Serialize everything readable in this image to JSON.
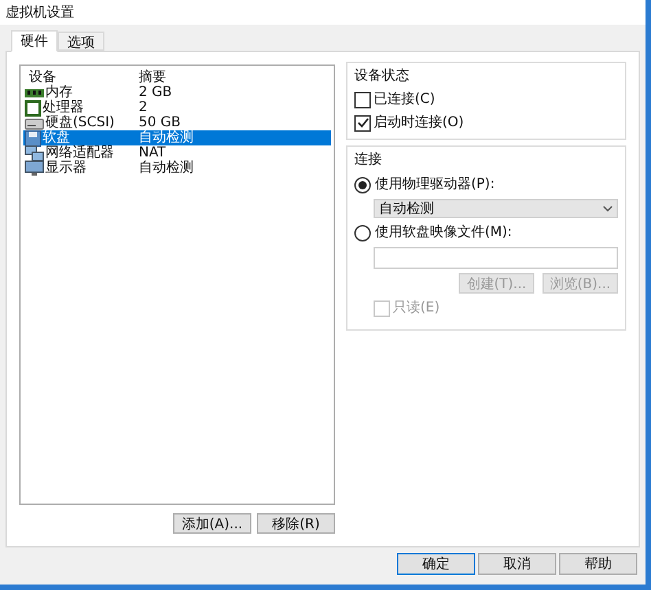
{
  "window": {
    "title": "虚拟机设置"
  },
  "tabs": [
    {
      "label": "硬件",
      "selected": true
    },
    {
      "label": "选项",
      "selected": false
    }
  ],
  "device_list": {
    "columns": [
      "设备",
      "摘要"
    ],
    "rows": [
      {
        "kind": "memory",
        "name": "内存",
        "summary": "2 GB",
        "selected": false
      },
      {
        "kind": "cpu",
        "name": "处理器",
        "summary": "2",
        "selected": false
      },
      {
        "kind": "disk",
        "name": "硬盘(SCSI)",
        "summary": "50 GB",
        "selected": false
      },
      {
        "kind": "floppy",
        "name": "软盘",
        "summary": "自动检测",
        "selected": true
      },
      {
        "kind": "network",
        "name": "网络适配器",
        "summary": "NAT",
        "selected": false
      },
      {
        "kind": "display",
        "name": "显示器",
        "summary": "自动检测",
        "selected": false
      }
    ],
    "buttons": [
      "添加(A)...",
      "移除(R)"
    ]
  },
  "device_status": {
    "title": "设备状态",
    "options": [
      {
        "label": "已连接(C)",
        "checked": false
      },
      {
        "label": "启动时连接(O)",
        "checked": true
      }
    ]
  },
  "connection": {
    "title": "连接",
    "physical": {
      "label": "使用物理驱动器(P):",
      "selected": true,
      "value": "自动检测"
    },
    "image": {
      "label": "使用软盘映像文件(M):",
      "selected": false,
      "buttons": [
        "创建(T)...",
        "浏览(B)..."
      ],
      "readonly": {
        "label": "只读(E)",
        "checked": false,
        "disabled": true
      }
    }
  },
  "footer_buttons": [
    {
      "label": "确定",
      "default": true
    },
    {
      "label": "取消",
      "default": false
    },
    {
      "label": "帮助",
      "default": false
    }
  ]
}
